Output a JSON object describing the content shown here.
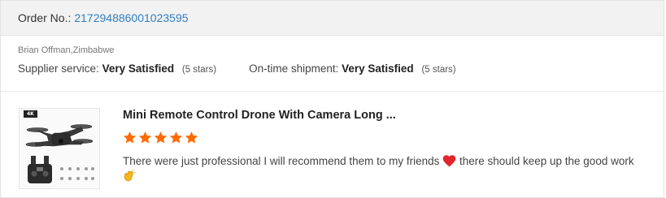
{
  "order": {
    "label": "Order No.:",
    "number": "217294886001023595"
  },
  "buyer": {
    "name_location": "Brian Offman,Zimbabwe"
  },
  "ratings": {
    "supplier_label": "Supplier service:",
    "supplier_value": "Very Satisfied",
    "supplier_stars": "(5 stars)",
    "shipment_label": "On-time shipment:",
    "shipment_value": "Very Satisfied",
    "shipment_stars": "(5 stars)"
  },
  "product": {
    "title": "Mini Remote Control Drone With Camera Long ...",
    "thumbnail_badge": "4K",
    "thumbnail_icon": "drone-image",
    "rating": 5,
    "rating_max": 5
  },
  "review": {
    "text_part1": "There were just professional I will recommend them to my friends",
    "emoji1": "heart-icon",
    "text_part2": "there should keep up the good work",
    "emoji2": "clapping-hands-icon"
  },
  "colors": {
    "link": "#2f7fc1",
    "star": "#ff6a00",
    "header_bg": "#f2f2f2",
    "heart": "#e0262d",
    "clap": "#f5b71e"
  }
}
